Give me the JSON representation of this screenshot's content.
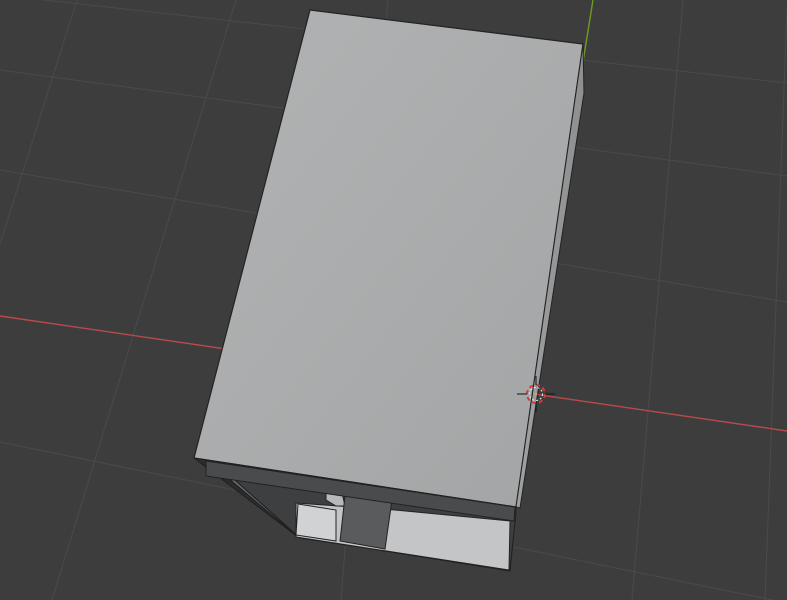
{
  "viewport": {
    "background_color": "#3d3d3d",
    "grid_color": "#4a4a4a",
    "x_axis_color": "#b84a4a",
    "y_axis_color": "#6f9a22"
  },
  "object": {
    "top_face_color": "#a7a9aa",
    "inner_face_color": "#c3c4c5",
    "dark_face_color": "#5b5c5d",
    "edge_color": "#1f1f1f"
  },
  "cursor": {
    "icon": "3d-cursor-icon",
    "ring_color_1": "#d23c3c",
    "ring_color_2": "#f1f1f1"
  }
}
